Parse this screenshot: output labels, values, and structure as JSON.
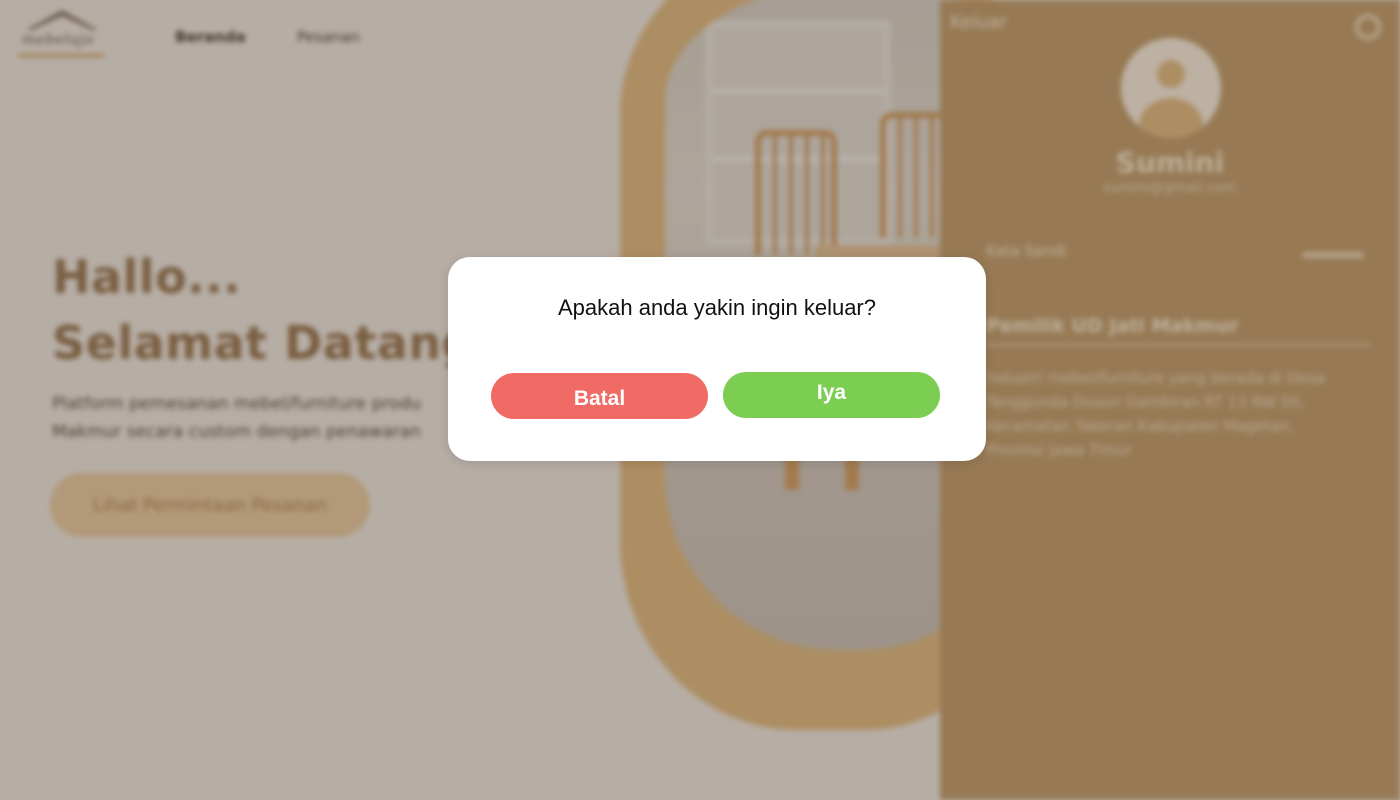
{
  "colors": {
    "accent": "#c7a574",
    "cancel": "#f06a66",
    "confirm": "#7bce52",
    "overlay": "rgba(55,36,20,0.33)"
  },
  "logo": {
    "text": "mebelajo"
  },
  "nav": {
    "items": [
      {
        "label": "Beranda",
        "active": true
      },
      {
        "label": "Pesanan",
        "active": false
      }
    ]
  },
  "hero": {
    "greeting": "Hallo...",
    "welcome": "Selamat Datang!",
    "description": "Platform pemesanan mebel/furniture produ Makmur secara custom dengan penawaran",
    "cta_label": "Lihat Permintaan Pesanan"
  },
  "sidebar": {
    "logout_label": "Keluar",
    "settings_icon": "gear-icon",
    "name": "Sumini",
    "email": "sumini@gmail.com",
    "password_label": "Kata Sandi",
    "role": "Pemilik UD Jati Makmur",
    "description": "Industri mebel/furniture yang berada di Desa Tanggunda Dusun Gambiran RT 13 RW 05, Kecamatan Takeran Kabupaten Magetan, Provinsi Jawa Timur"
  },
  "modal": {
    "question": "Apakah anda yakin ingin keluar?",
    "cancel_label": "Batal",
    "confirm_label": "Iya"
  }
}
